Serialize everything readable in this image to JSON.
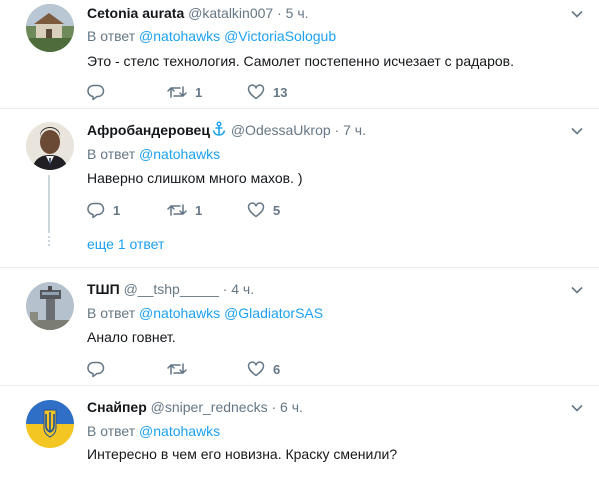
{
  "tweets": [
    {
      "name": "Cetonia aurata",
      "handle": "@katalkin007",
      "sep": "·",
      "time": "5 ч.",
      "reply_prefix": "В ответ",
      "mentions": [
        "@natohawks",
        "@VictoriaSologub"
      ],
      "text": "Это - стелс технология. Самолет постепенно исчезает с радаров.",
      "reply_count": "",
      "retweet_count": "1",
      "like_count": "13"
    },
    {
      "name": "Афробандеровец",
      "handle": "@OdessaUkrop",
      "sep": "·",
      "time": "7 ч.",
      "reply_prefix": "В ответ",
      "mentions": [
        "@natohawks"
      ],
      "text": "Наверно слишком много махов. )",
      "reply_count": "1",
      "retweet_count": "1",
      "like_count": "5",
      "more_replies": "еще 1 ответ"
    },
    {
      "name": "ТШП",
      "handle": "@__tshp_____",
      "sep": "·",
      "time": "4 ч.",
      "reply_prefix": "В ответ",
      "mentions": [
        "@natohawks",
        "@GladiatorSAS"
      ],
      "text": "Анало говнет.",
      "reply_count": "",
      "retweet_count": "",
      "like_count": "6"
    },
    {
      "name": "Снайпер",
      "handle": "@sniper_rednecks",
      "sep": "·",
      "time": "6 ч.",
      "reply_prefix": "В ответ",
      "mentions": [
        "@natohawks"
      ],
      "text": "Интересно в чем его новизна. Краску сменили?"
    }
  ],
  "colors": {
    "accent": "#1da1f2",
    "secondary_text": "#657786",
    "separator": "#e6ecf0",
    "verified_anchor": "#1da1f2"
  },
  "icons": {
    "reply": "reply-icon",
    "retweet": "retweet-icon",
    "like": "heart-icon",
    "caret": "chevron-down-icon",
    "anchor": "anchor-icon"
  }
}
